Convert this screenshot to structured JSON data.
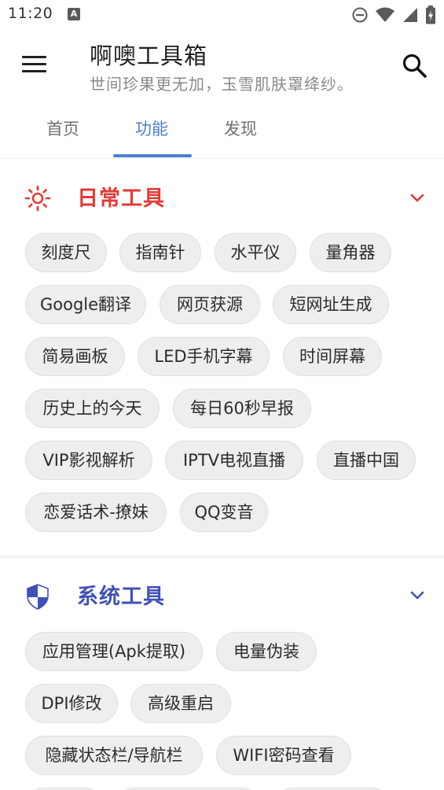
{
  "status_bar": {
    "time": "11:20",
    "notification_icon": "a-notification-icon",
    "icons": [
      "do-not-disturb-icon",
      "wifi-icon",
      "signal-icon",
      "battery-charging-icon"
    ]
  },
  "app_bar": {
    "title": "啊噢工具箱",
    "subtitle": "世间珍果更无加，玉雪肌肤罩绛纱。",
    "menu_icon": "menu-icon",
    "search_icon": "search-icon"
  },
  "tabs": [
    {
      "label": "首页",
      "active": false
    },
    {
      "label": "功能",
      "active": true
    },
    {
      "label": "发现",
      "active": false
    }
  ],
  "colors": {
    "accent_blue": "#4a7fd1",
    "daily_red": "#e53935",
    "system_blue": "#3f51b5",
    "chip_bg": "#eeeeee"
  },
  "sections": [
    {
      "title": "日常工具",
      "icon": "sun-icon",
      "expanded": true,
      "chips": [
        "刻度尺",
        "指南针",
        "水平仪",
        "量角器",
        "Google翻译",
        "网页获源",
        "短网址生成",
        "简易画板",
        "LED手机字幕",
        "时间屏幕",
        "历史上的今天",
        "每日60秒早报",
        "VIP影视解析",
        "IPTV电视直播",
        "直播中国",
        "恋爱话术-撩妹",
        "QQ变音"
      ]
    },
    {
      "title": "系统工具",
      "icon": "shield-icon",
      "expanded": true,
      "chips": [
        "应用管理(Apk提取)",
        "电量伪装",
        "DPI修改",
        "高级重启",
        "隐藏状态栏/导航栏",
        "WIFI密码查看"
      ]
    }
  ]
}
